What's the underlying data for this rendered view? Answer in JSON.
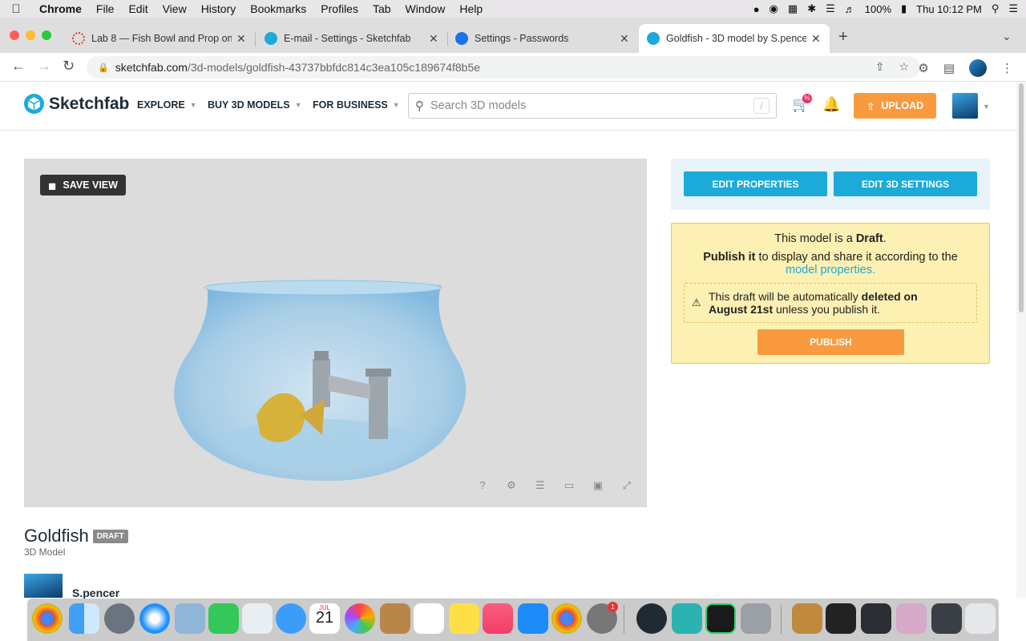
{
  "menubar": {
    "app": "Chrome",
    "items": [
      "File",
      "Edit",
      "View",
      "History",
      "Bookmarks",
      "Profiles",
      "Tab",
      "Window",
      "Help"
    ],
    "battery": "100%",
    "clock": "Thu 10:12 PM"
  },
  "tabs": [
    {
      "title": "Lab 8 — Fish Bowl and Prop on",
      "icon_color": "#e0363a"
    },
    {
      "title": "E-mail - Settings - Sketchfab",
      "icon_color": "#1caad9"
    },
    {
      "title": "Settings - Passwords",
      "icon_color": "#1a73e8"
    },
    {
      "title": "Goldfish - 3D model by S.pencer",
      "icon_color": "#1caad9"
    }
  ],
  "address": {
    "domain": "sketchfab.com",
    "path": "/3d-models/goldfish-43737bbfdc814c3ea105c189674f8b5e"
  },
  "header": {
    "logo": "Sketchfab",
    "nav": [
      "EXPLORE",
      "BUY 3D MODELS",
      "FOR BUSINESS"
    ],
    "search_placeholder": "Search 3D models",
    "search_shortcut": "/",
    "upload": "UPLOAD",
    "cart_badge": "%"
  },
  "viewer": {
    "save_view": "SAVE VIEW"
  },
  "side": {
    "edit_properties": "EDIT PROPERTIES",
    "edit_3d_settings": "EDIT 3D SETTINGS",
    "draft_pre": "This model is a ",
    "draft_word": "Draft",
    "draft_post": ".",
    "publish_bold": "Publish it",
    "publish_text": " to display and share it according to the",
    "model_props_link": "model properties.",
    "warn_pre": "This draft will be automatically ",
    "warn_bold1": "deleted on",
    "warn_bold2": "August 21st",
    "warn_post": " unless you publish it.",
    "publish_btn": "PUBLISH"
  },
  "model": {
    "title": "Goldfish",
    "badge": "DRAFT",
    "subtitle": "3D Model",
    "author": "S.pencer"
  },
  "dock": {
    "calendar_month": "JUL",
    "calendar_day": "21",
    "badge": "1"
  }
}
